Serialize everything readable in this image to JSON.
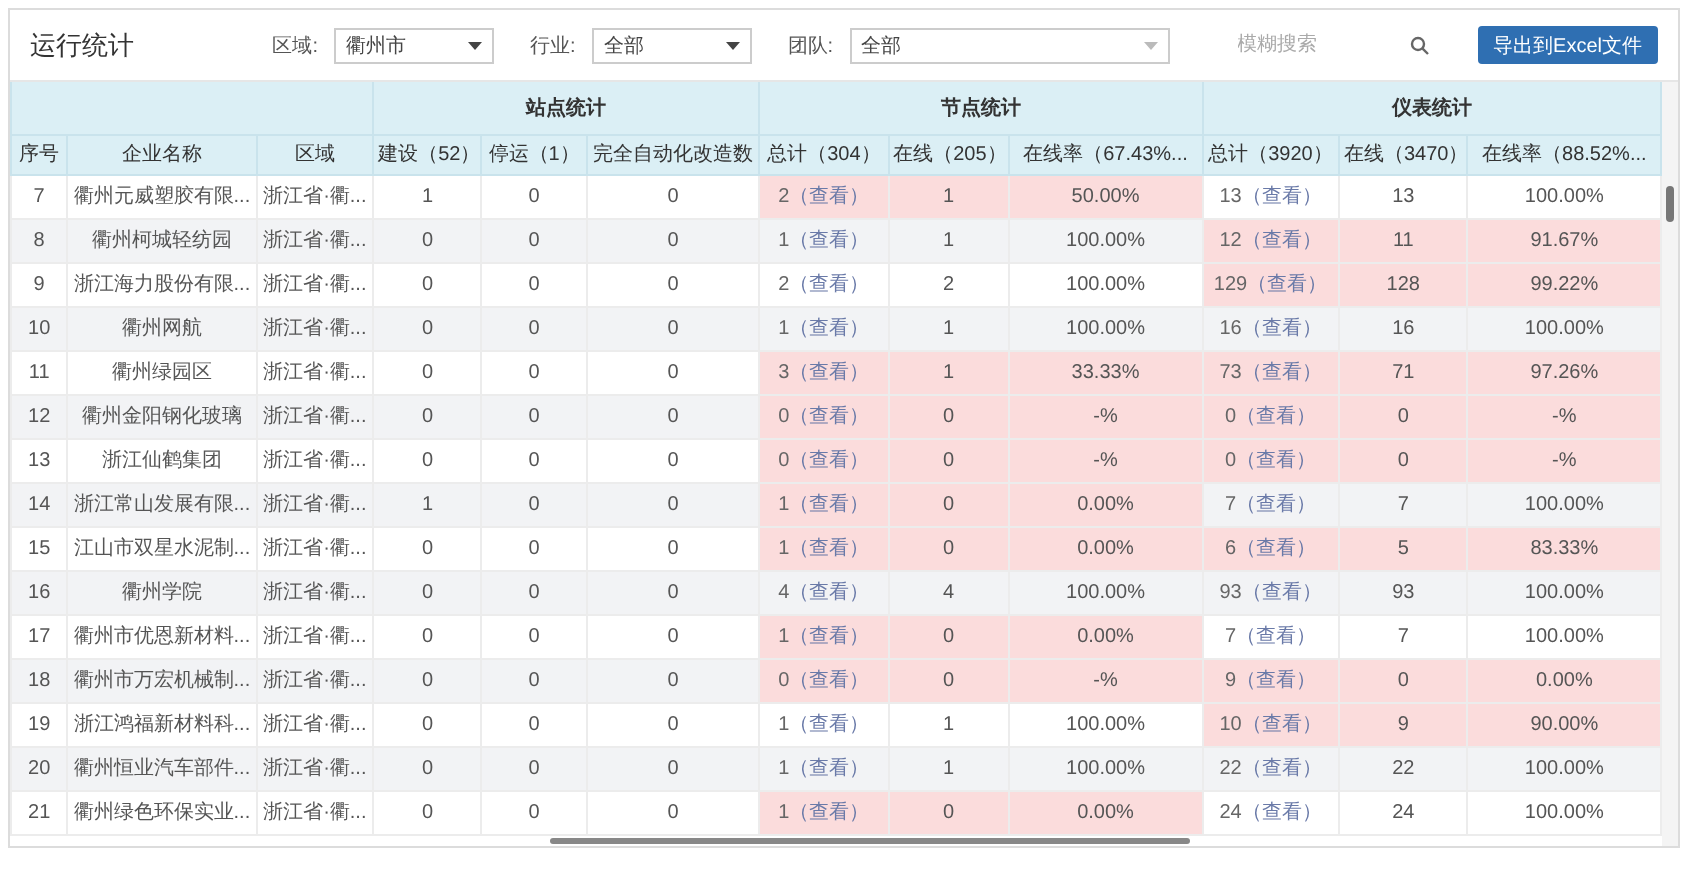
{
  "header": {
    "title": "运行统计",
    "filters": [
      {
        "label": "区域:",
        "value": "衢州市"
      },
      {
        "label": "行业:",
        "value": "全部"
      },
      {
        "label": "团队:",
        "value": "全部"
      }
    ],
    "search": {
      "placeholder": "模糊搜索"
    },
    "export_button": "导出到Excel文件"
  },
  "table": {
    "base_columns": [
      "序号",
      "企业名称",
      "区域"
    ],
    "column_groups": [
      {
        "title": "站点统计",
        "columns": [
          "建设（52）",
          "停运（1）",
          "完全自动化改造数"
        ]
      },
      {
        "title": "节点统计",
        "columns": [
          "总计（304）",
          "在线（205）",
          "在线率（67.43%..."
        ]
      },
      {
        "title": "仪表统计",
        "columns": [
          "总计（3920）",
          "在线（3470）",
          "在线率（88.52%..."
        ]
      }
    ],
    "rows": [
      {
        "index": "7",
        "company": "衢州元威塑胶有限...",
        "region": "浙江省·衢...",
        "station": [
          "1",
          "0",
          "0"
        ],
        "node": {
          "total": "2",
          "view": "（查看）",
          "online": "1",
          "rate": "50.00%",
          "alert": true
        },
        "instrument": {
          "total": "13",
          "view": "（查看）",
          "online": "13",
          "rate": "100.00%",
          "alert": false
        }
      },
      {
        "index": "8",
        "company": "衢州柯城轻纺园",
        "region": "浙江省·衢...",
        "station": [
          "0",
          "0",
          "0"
        ],
        "node": {
          "total": "1",
          "view": "（查看）",
          "online": "1",
          "rate": "100.00%",
          "alert": false
        },
        "instrument": {
          "total": "12",
          "view": "（查看）",
          "online": "11",
          "rate": "91.67%",
          "alert": true
        }
      },
      {
        "index": "9",
        "company": "浙江海力股份有限...",
        "region": "浙江省·衢...",
        "station": [
          "0",
          "0",
          "0"
        ],
        "node": {
          "total": "2",
          "view": "（查看）",
          "online": "2",
          "rate": "100.00%",
          "alert": false
        },
        "instrument": {
          "total": "129",
          "view": "（查看）",
          "online": "128",
          "rate": "99.22%",
          "alert": true
        }
      },
      {
        "index": "10",
        "company": "衢州网航",
        "region": "浙江省·衢...",
        "station": [
          "0",
          "0",
          "0"
        ],
        "node": {
          "total": "1",
          "view": "（查看）",
          "online": "1",
          "rate": "100.00%",
          "alert": false
        },
        "instrument": {
          "total": "16",
          "view": "（查看）",
          "online": "16",
          "rate": "100.00%",
          "alert": false
        }
      },
      {
        "index": "11",
        "company": "衢州绿园区",
        "region": "浙江省·衢...",
        "station": [
          "0",
          "0",
          "0"
        ],
        "node": {
          "total": "3",
          "view": "（查看）",
          "online": "1",
          "rate": "33.33%",
          "alert": true
        },
        "instrument": {
          "total": "73",
          "view": "（查看）",
          "online": "71",
          "rate": "97.26%",
          "alert": true
        }
      },
      {
        "index": "12",
        "company": "衢州金阳钢化玻璃",
        "region": "浙江省·衢...",
        "station": [
          "0",
          "0",
          "0"
        ],
        "node": {
          "total": "0",
          "view": "（查看）",
          "online": "0",
          "rate": "-%",
          "alert": true
        },
        "instrument": {
          "total": "0",
          "view": "（查看）",
          "online": "0",
          "rate": "-%",
          "alert": true
        }
      },
      {
        "index": "13",
        "company": "浙江仙鹤集团",
        "region": "浙江省·衢...",
        "station": [
          "0",
          "0",
          "0"
        ],
        "node": {
          "total": "0",
          "view": "（查看）",
          "online": "0",
          "rate": "-%",
          "alert": true
        },
        "instrument": {
          "total": "0",
          "view": "（查看）",
          "online": "0",
          "rate": "-%",
          "alert": true
        }
      },
      {
        "index": "14",
        "company": "浙江常山发展有限...",
        "region": "浙江省·衢...",
        "station": [
          "1",
          "0",
          "0"
        ],
        "node": {
          "total": "1",
          "view": "（查看）",
          "online": "0",
          "rate": "0.00%",
          "alert": true
        },
        "instrument": {
          "total": "7",
          "view": "（查看）",
          "online": "7",
          "rate": "100.00%",
          "alert": false
        }
      },
      {
        "index": "15",
        "company": "江山市双星水泥制...",
        "region": "浙江省·衢...",
        "station": [
          "0",
          "0",
          "0"
        ],
        "node": {
          "total": "1",
          "view": "（查看）",
          "online": "0",
          "rate": "0.00%",
          "alert": true
        },
        "instrument": {
          "total": "6",
          "view": "（查看）",
          "online": "5",
          "rate": "83.33%",
          "alert": true
        }
      },
      {
        "index": "16",
        "company": "衢州学院",
        "region": "浙江省·衢...",
        "station": [
          "0",
          "0",
          "0"
        ],
        "node": {
          "total": "4",
          "view": "（查看）",
          "online": "4",
          "rate": "100.00%",
          "alert": false
        },
        "instrument": {
          "total": "93",
          "view": "（查看）",
          "online": "93",
          "rate": "100.00%",
          "alert": false
        }
      },
      {
        "index": "17",
        "company": "衢州市优恩新材料...",
        "region": "浙江省·衢...",
        "station": [
          "0",
          "0",
          "0"
        ],
        "node": {
          "total": "1",
          "view": "（查看）",
          "online": "0",
          "rate": "0.00%",
          "alert": true
        },
        "instrument": {
          "total": "7",
          "view": "（查看）",
          "online": "7",
          "rate": "100.00%",
          "alert": false
        }
      },
      {
        "index": "18",
        "company": "衢州市万宏机械制...",
        "region": "浙江省·衢...",
        "station": [
          "0",
          "0",
          "0"
        ],
        "node": {
          "total": "0",
          "view": "（查看）",
          "online": "0",
          "rate": "-%",
          "alert": true
        },
        "instrument": {
          "total": "9",
          "view": "（查看）",
          "online": "0",
          "rate": "0.00%",
          "alert": true
        }
      },
      {
        "index": "19",
        "company": "浙江鸿福新材料科...",
        "region": "浙江省·衢...",
        "station": [
          "0",
          "0",
          "0"
        ],
        "node": {
          "total": "1",
          "view": "（查看）",
          "online": "1",
          "rate": "100.00%",
          "alert": false
        },
        "instrument": {
          "total": "10",
          "view": "（查看）",
          "online": "9",
          "rate": "90.00%",
          "alert": true
        }
      },
      {
        "index": "20",
        "company": "衢州恒业汽车部件...",
        "region": "浙江省·衢...",
        "station": [
          "0",
          "0",
          "0"
        ],
        "node": {
          "total": "1",
          "view": "（查看）",
          "online": "1",
          "rate": "100.00%",
          "alert": false
        },
        "instrument": {
          "total": "22",
          "view": "（查看）",
          "online": "22",
          "rate": "100.00%",
          "alert": false
        }
      },
      {
        "index": "21",
        "company": "衢州绿色环保实业...",
        "region": "浙江省·衢...",
        "station": [
          "0",
          "0",
          "0"
        ],
        "node": {
          "total": "1",
          "view": "（查看）",
          "online": "0",
          "rate": "0.00%",
          "alert": true
        },
        "instrument": {
          "total": "24",
          "view": "（查看）",
          "online": "24",
          "rate": "100.00%",
          "alert": false
        }
      }
    ]
  }
}
